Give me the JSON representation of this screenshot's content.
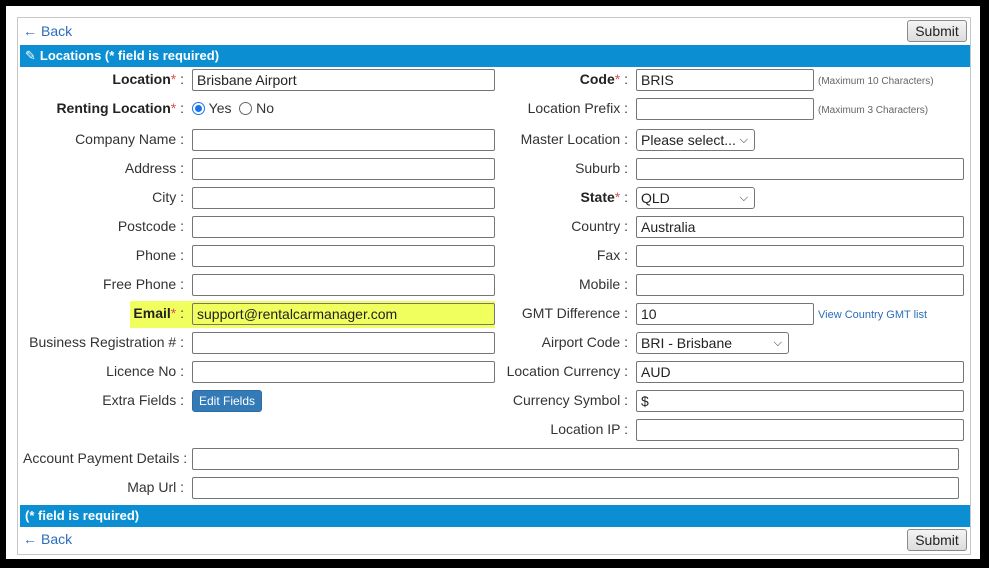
{
  "nav": {
    "back_label": "Back",
    "submit_label": "Submit"
  },
  "header": {
    "title": "Locations (* field is required)"
  },
  "footer": {
    "note": "(* field is required)"
  },
  "form": {
    "location": {
      "label": "Location",
      "value": "Brisbane Airport"
    },
    "renting_location": {
      "label": "Renting Location",
      "options": [
        "Yes",
        "No"
      ],
      "selected": "Yes"
    },
    "company_name": {
      "label": "Company Name",
      "value": ""
    },
    "address": {
      "label": "Address",
      "value": ""
    },
    "city": {
      "label": "City",
      "value": ""
    },
    "postcode": {
      "label": "Postcode",
      "value": ""
    },
    "phone": {
      "label": "Phone",
      "value": ""
    },
    "free_phone": {
      "label": "Free Phone",
      "value": ""
    },
    "email": {
      "label": "Email",
      "value": "support@rentalcarmanager.com"
    },
    "business_registration": {
      "label": "Business Registration #",
      "value": ""
    },
    "licence_no": {
      "label": "Licence No",
      "value": ""
    },
    "extra_fields": {
      "label": "Extra Fields",
      "button_label": "Edit Fields"
    },
    "code": {
      "label": "Code",
      "value": "BRIS",
      "hint": "(Maximum 10 Characters)"
    },
    "location_prefix": {
      "label": "Location Prefix",
      "value": "",
      "hint": "(Maximum 3 Characters)"
    },
    "master_location": {
      "label": "Master Location",
      "selected": "Please select..."
    },
    "suburb": {
      "label": "Suburb",
      "value": ""
    },
    "state": {
      "label": "State",
      "selected": "QLD"
    },
    "country": {
      "label": "Country",
      "value": "Australia"
    },
    "fax": {
      "label": "Fax",
      "value": ""
    },
    "mobile": {
      "label": "Mobile",
      "value": ""
    },
    "gmt_difference": {
      "label": "GMT Difference",
      "value": "10",
      "link": "View Country GMT list"
    },
    "airport_code": {
      "label": "Airport Code",
      "selected": "BRI - Brisbane"
    },
    "location_currency": {
      "label": "Location Currency",
      "value": "AUD"
    },
    "currency_symbol": {
      "label": "Currency Symbol",
      "value": "$"
    },
    "location_ip": {
      "label": "Location IP",
      "value": ""
    },
    "account_payment_details": {
      "label": "Account Payment Details",
      "value": ""
    },
    "map_url": {
      "label": "Map Url",
      "value": ""
    }
  },
  "colors": {
    "bar": "#0b8ed2",
    "link": "#2a6ebb",
    "required": "#d9534f",
    "email_highlight": "#f1ff5e",
    "edit_button": "#337ab7"
  },
  "icons": {
    "back": "arrow-left-icon",
    "header": "pencil-icon",
    "select": "chevron-down-icon"
  }
}
